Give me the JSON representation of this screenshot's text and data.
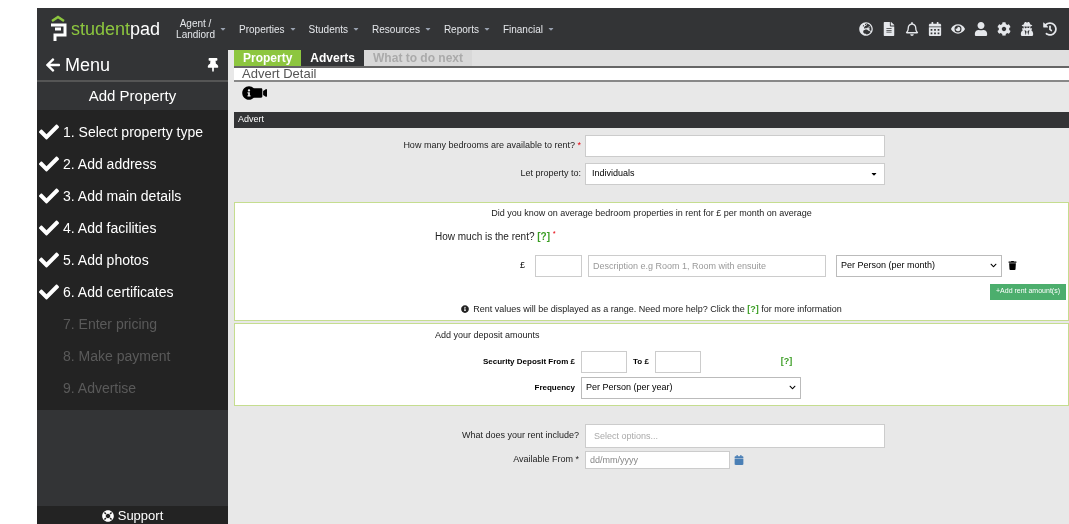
{
  "brand": {
    "name_bold": "student",
    "name_light": "pad"
  },
  "nav": [
    {
      "label": "Agent /\nLandiord"
    },
    {
      "label": "Properties"
    },
    {
      "label": "Students"
    },
    {
      "label": "Resources"
    },
    {
      "label": "Reports"
    },
    {
      "label": "Financial"
    }
  ],
  "sidebar": {
    "menu_label": "Menu",
    "title": "Add Property",
    "steps": [
      {
        "label": "1. Select property type",
        "done": true
      },
      {
        "label": "2. Add address",
        "done": true
      },
      {
        "label": "3. Add main details",
        "done": true
      },
      {
        "label": "4. Add facilities",
        "done": true
      },
      {
        "label": "5. Add photos",
        "done": true
      },
      {
        "label": "6. Add certificates",
        "done": true
      },
      {
        "label": "7. Enter pricing",
        "done": false
      },
      {
        "label": "8. Make payment",
        "done": false
      },
      {
        "label": "9. Advertise",
        "done": false
      }
    ],
    "support": "Support"
  },
  "tabs": [
    {
      "label": "Property",
      "selected": true,
      "disabled": false
    },
    {
      "label": "Adverts",
      "selected": false,
      "disabled": false
    },
    {
      "label": "What to do next",
      "selected": false,
      "disabled": true
    }
  ],
  "page_title": "Advert Detail",
  "section_title": "Advert",
  "bedrooms": {
    "label": "How many bedrooms are available to rent?",
    "required": "*"
  },
  "let_to": {
    "label": "Let property to:",
    "value": "Individuals"
  },
  "rent": {
    "notice": "Did you know on average bedroom properties in rent for £ per month on average",
    "question": "How much is the rent?",
    "help": "[?]",
    "required": "*",
    "currency": "£",
    "description_placeholder": "Description e.g Room 1, Room with ensuite",
    "period": "Per Person (per month)",
    "add_button": "+Add rent amount(s)",
    "info": "Rent values will be displayed as a range. Need more help? Click the **[?]** for more information"
  },
  "deposit": {
    "title": "Add your deposit amounts",
    "from_label": "Security Deposit From £",
    "to_label": "To £",
    "help": "[?]",
    "frequency_label": "Frequency",
    "frequency": "Per Person (per year)"
  },
  "includes": {
    "label": "What does your rent include?",
    "placeholder": "Select options..."
  },
  "available": {
    "label": "Available From *",
    "placeholder": "dd/mm/yyyy"
  }
}
